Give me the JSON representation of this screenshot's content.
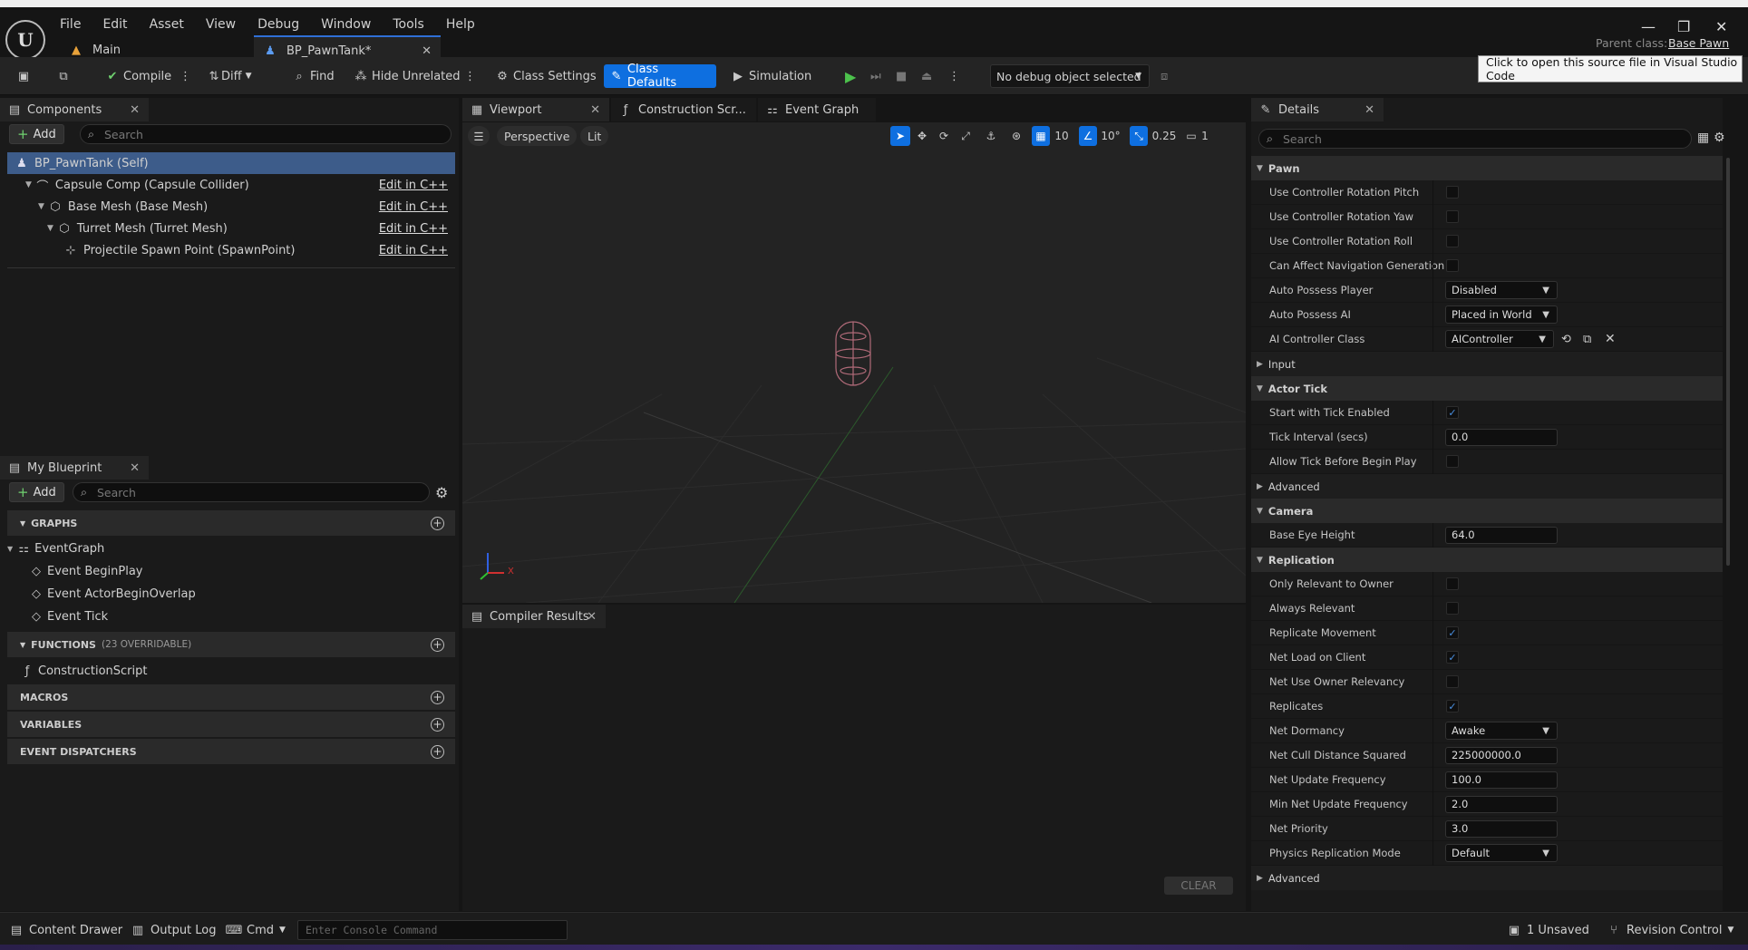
{
  "app": {
    "menu": [
      "File",
      "Edit",
      "Asset",
      "View",
      "Debug",
      "Window",
      "Tools",
      "Help"
    ],
    "tabs": [
      {
        "label": "Main"
      },
      {
        "label": "BP_PawnTank*"
      }
    ],
    "parent_class_label": "Parent class:",
    "parent_class_value": "Base Pawn",
    "tooltip": "Click to open this source file in Visual Studio Code"
  },
  "toolbar": {
    "compile": "Compile",
    "diff": "Diff",
    "find": "Find",
    "hide_unrelated": "Hide Unrelated",
    "class_settings": "Class Settings",
    "class_defaults": "Class Defaults",
    "simulation": "Simulation",
    "debug_object": "No debug object selected"
  },
  "components": {
    "tab": "Components",
    "add": "Add",
    "search_placeholder": "Search",
    "items": [
      {
        "label": "BP_PawnTank (Self)",
        "edit": ""
      },
      {
        "label": "Capsule Comp (Capsule Collider)",
        "edit": "Edit in C++"
      },
      {
        "label": "Base Mesh (Base Mesh)",
        "edit": "Edit in C++"
      },
      {
        "label": "Turret Mesh (Turret Mesh)",
        "edit": "Edit in C++"
      },
      {
        "label": "Projectile Spawn Point (SpawnPoint)",
        "edit": "Edit in C++"
      }
    ]
  },
  "my_blueprint": {
    "tab": "My Blueprint",
    "add": "Add",
    "search_placeholder": "Search",
    "graphs_label": "GRAPHS",
    "event_graph": "EventGraph",
    "events": [
      "Event BeginPlay",
      "Event ActorBeginOverlap",
      "Event Tick"
    ],
    "functions_label": "FUNCTIONS",
    "functions_count": "(23 OVERRIDABLE)",
    "construction_script": "ConstructionScript",
    "macros_label": "MACROS",
    "variables_label": "VARIABLES",
    "dispatchers_label": "EVENT DISPATCHERS"
  },
  "center_tabs": [
    "Viewport",
    "Construction Scr...",
    "Event Graph"
  ],
  "viewport": {
    "perspective": "Perspective",
    "lit": "Lit",
    "grid_snap": "10",
    "rot_snap": "10°",
    "scale_snap": "0.25",
    "camera_speed": "1",
    "axis_x": "X"
  },
  "compiler": {
    "tab": "Compiler Results",
    "clear": "CLEAR"
  },
  "details": {
    "tab": "Details",
    "search_placeholder": "Search",
    "pawn": {
      "category": "Pawn",
      "rows": [
        {
          "label": "Use Controller Rotation Pitch",
          "checked": ""
        },
        {
          "label": "Use Controller Rotation Yaw",
          "checked": ""
        },
        {
          "label": "Use Controller Rotation Roll",
          "checked": ""
        },
        {
          "label": "Can Affect Navigation Generation",
          "checked": ""
        }
      ],
      "auto_possess_player_label": "Auto Possess Player",
      "auto_possess_player": "Disabled",
      "auto_possess_ai_label": "Auto Possess AI",
      "auto_possess_ai": "Placed in World",
      "ai_controller_label": "AI Controller Class",
      "ai_controller": "AIController"
    },
    "input": "Input",
    "actor_tick": {
      "category": "Actor Tick",
      "start_tick_label": "Start with Tick Enabled",
      "start_tick": "✓",
      "tick_interval_label": "Tick Interval (secs)",
      "tick_interval": "0.0",
      "allow_tick_label": "Allow Tick Before Begin Play",
      "allow_tick": ""
    },
    "advanced": "Advanced",
    "camera": {
      "category": "Camera",
      "eye_height_label": "Base Eye Height",
      "eye_height": "64.0"
    },
    "replication": {
      "category": "Replication",
      "checks": [
        {
          "label": "Only Relevant to Owner",
          "checked": ""
        },
        {
          "label": "Always Relevant",
          "checked": ""
        },
        {
          "label": "Replicate Movement",
          "checked": "✓"
        },
        {
          "label": "Net Load on Client",
          "checked": "✓"
        },
        {
          "label": "Net Use Owner Relevancy",
          "checked": ""
        },
        {
          "label": "Replicates",
          "checked": "✓"
        }
      ],
      "net_dormancy_label": "Net Dormancy",
      "net_dormancy": "Awake",
      "net_cull_label": "Net Cull Distance Squared",
      "net_cull": "225000000.0",
      "net_update_label": "Net Update Frequency",
      "net_update": "100.0",
      "min_net_update_label": "Min Net Update Frequency",
      "min_net_update": "2.0",
      "net_priority_label": "Net Priority",
      "net_priority": "3.0",
      "physics_mode_label": "Physics Replication Mode",
      "physics_mode": "Default"
    },
    "advanced2": "Advanced"
  },
  "statusbar": {
    "content_drawer": "Content Drawer",
    "output_log": "Output Log",
    "cmd": "Cmd",
    "console_placeholder": "Enter Console Command",
    "unsaved": "1 Unsaved",
    "revision_control": "Revision Control"
  }
}
